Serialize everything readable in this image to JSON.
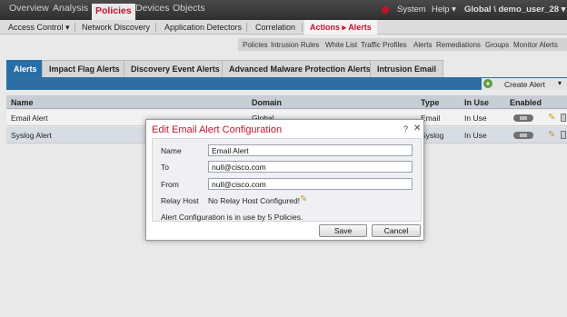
{
  "topnav": {
    "items": [
      "Overview",
      "Analysis",
      "Policies",
      "Devices",
      "Objects"
    ],
    "active": "Policies",
    "right": {
      "system": "System",
      "help": "Help ▾",
      "user": "Global \\ demo_user_28 ▾"
    }
  },
  "subnav": {
    "items": [
      "Access Control ▾",
      "Network Discovery",
      "Application Detectors",
      "Correlation",
      "Actions ▸ Alerts"
    ],
    "active": "Actions ▸ Alerts"
  },
  "thirdnav": {
    "items": [
      "Policies",
      "Intrusion Rules",
      "White List",
      "Traffic Profiles",
      "Alerts",
      "Remediations",
      "Groups",
      "Monitor Alerts"
    ]
  },
  "tabs": {
    "items": [
      "Alerts",
      "Impact Flag Alerts",
      "Discovery Event Alerts",
      "Advanced Malware Protection Alerts",
      "Intrusion Email"
    ],
    "active": "Alerts"
  },
  "toolbar": {
    "create_label": "Create Alert"
  },
  "table": {
    "headers": {
      "name": "Name",
      "domain": "Domain",
      "type": "Type",
      "in_use": "In Use",
      "enabled": "Enabled"
    },
    "rows": [
      {
        "name": "Email Alert",
        "domain": "Global",
        "type": "Email",
        "in_use": "In Use"
      },
      {
        "name": "Syslog Alert",
        "domain": "",
        "type": "Syslog",
        "in_use": "In Use"
      }
    ]
  },
  "dialog": {
    "title": "Edit Email Alert Configuration",
    "help": "?",
    "close": "✕",
    "fields": {
      "name_label": "Name",
      "name_value": "Email Alert",
      "to_label": "To",
      "to_value": "null@cisco.com",
      "from_label": "From",
      "from_value": "null@cisco.com",
      "relay_label": "Relay Host",
      "relay_value": "No Relay Host Configured!"
    },
    "note": "Alert Configuration is in use by 5 Policies.",
    "save": "Save",
    "cancel": "Cancel"
  },
  "colors": {
    "brand_red": "#c8102e",
    "tab_blue": "#2a6ea6"
  }
}
